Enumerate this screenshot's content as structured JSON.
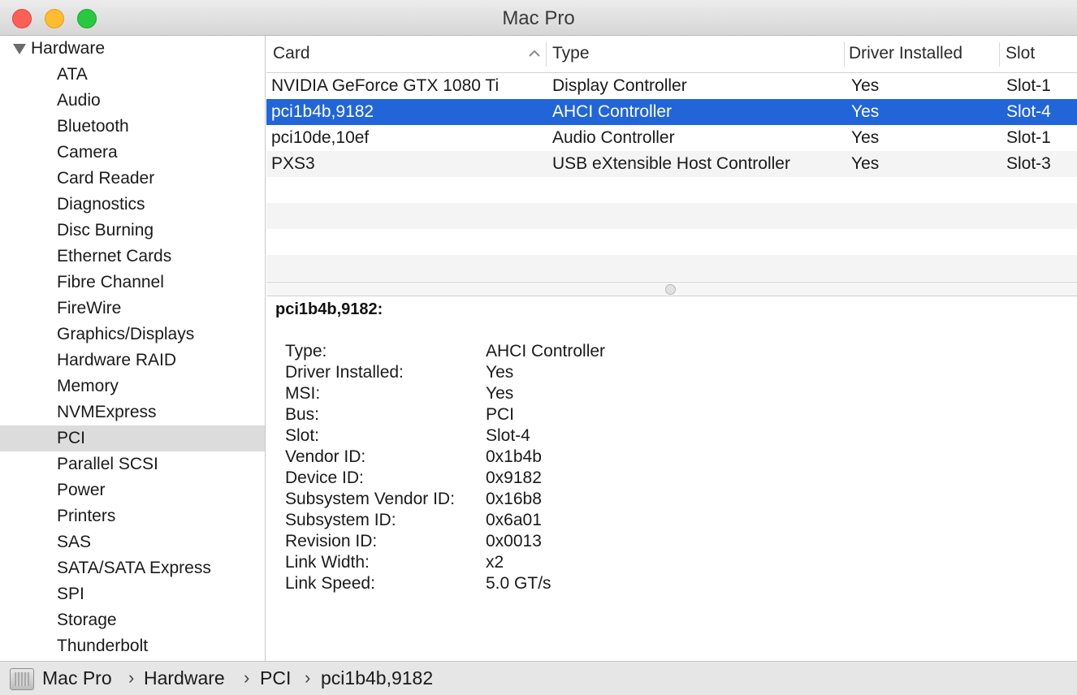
{
  "window": {
    "title": "Mac Pro"
  },
  "sidebar": {
    "group_label": "Hardware",
    "items": [
      "ATA",
      "Audio",
      "Bluetooth",
      "Camera",
      "Card Reader",
      "Diagnostics",
      "Disc Burning",
      "Ethernet Cards",
      "Fibre Channel",
      "FireWire",
      "Graphics/Displays",
      "Hardware RAID",
      "Memory",
      "NVMExpress",
      "PCI",
      "Parallel SCSI",
      "Power",
      "Printers",
      "SAS",
      "SATA/SATA Express",
      "SPI",
      "Storage",
      "Thunderbolt"
    ],
    "selected_item": "PCI"
  },
  "table": {
    "columns": [
      "Card",
      "Type",
      "Driver Installed",
      "Slot"
    ],
    "sort_indicator": "chevron-up-icon",
    "rows": [
      {
        "card": "NVIDIA GeForce GTX 1080 Ti",
        "type": "Display Controller",
        "driver": "Yes",
        "slot": "Slot-1"
      },
      {
        "card": "pci1b4b,9182",
        "type": "AHCI Controller",
        "driver": "Yes",
        "slot": "Slot-4"
      },
      {
        "card": "pci10de,10ef",
        "type": "Audio Controller",
        "driver": "Yes",
        "slot": "Slot-1"
      },
      {
        "card": "PXS3",
        "type": "USB eXtensible Host Controller",
        "driver": "Yes",
        "slot": "Slot-3"
      }
    ],
    "selected_row": 1
  },
  "detail": {
    "title": "pci1b4b,9182:",
    "fields": [
      {
        "label": "Type:",
        "value": "AHCI Controller"
      },
      {
        "label": "Driver Installed:",
        "value": "Yes"
      },
      {
        "label": "MSI:",
        "value": "Yes"
      },
      {
        "label": "Bus:",
        "value": "PCI"
      },
      {
        "label": "Slot:",
        "value": "Slot-4"
      },
      {
        "label": "Vendor ID:",
        "value": "0x1b4b"
      },
      {
        "label": "Device ID:",
        "value": "0x9182"
      },
      {
        "label": "Subsystem Vendor ID:",
        "value": "0x16b8"
      },
      {
        "label": "Subsystem ID:",
        "value": "0x6a01"
      },
      {
        "label": "Revision ID:",
        "value": "0x0013"
      },
      {
        "label": "Link Width:",
        "value": "x2"
      },
      {
        "label": "Link Speed:",
        "value": "5.0 GT/s"
      }
    ]
  },
  "pathbar": {
    "icon": "mac-pro-icon",
    "crumbs": [
      "Mac Pro",
      "Hardware",
      "PCI",
      "pci1b4b,9182"
    ],
    "separator": "›"
  },
  "colors": {
    "selection": "#2165d8",
    "sidebar_selection": "#dcdcdc",
    "close": "#fe5f57",
    "minimize": "#febc2e",
    "zoom": "#28c840"
  }
}
